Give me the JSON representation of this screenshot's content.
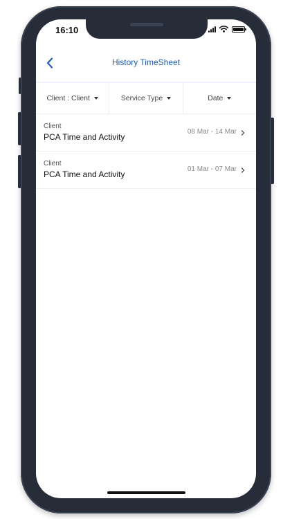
{
  "status_bar": {
    "time": "16:10"
  },
  "nav": {
    "title": "History TimeSheet"
  },
  "filters": [
    {
      "label": "Client : Client"
    },
    {
      "label": "Service Type"
    },
    {
      "label": "Date"
    }
  ],
  "timesheets": [
    {
      "client": "Client",
      "title": "PCA Time and Activity",
      "date_range": "08 Mar - 14 Mar"
    },
    {
      "client": "Client",
      "title": "PCA Time and Activity",
      "date_range": "01 Mar - 07 Mar"
    }
  ],
  "colors": {
    "accent": "#1f5cc5",
    "phone_frame": "#262c38"
  },
  "icons": [
    "back-chevron-icon",
    "caret-down-icon",
    "chevron-right-icon",
    "cellular-signal-icon",
    "wifi-icon",
    "battery-icon"
  ]
}
